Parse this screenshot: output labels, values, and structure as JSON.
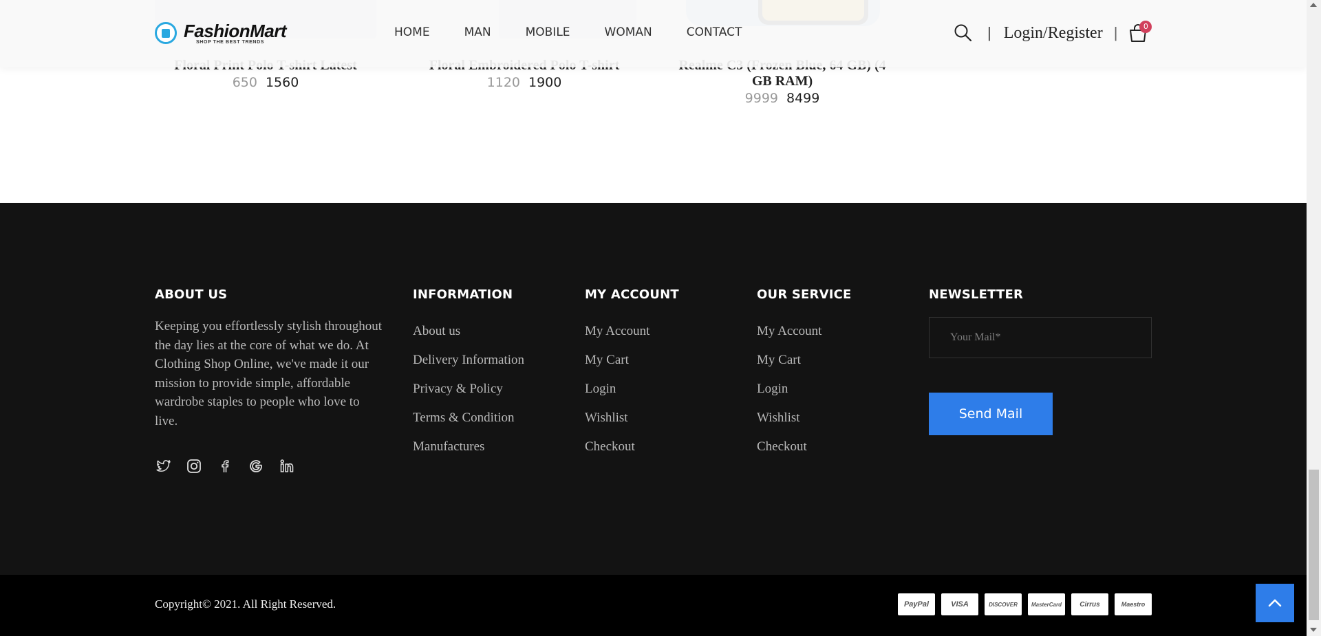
{
  "header": {
    "brand": "FashionMart",
    "tagline": "SHOP THE BEST TRENDS",
    "nav": [
      "HOME",
      "MAN",
      "MOBILE",
      "WOMAN",
      "CONTACT"
    ],
    "login_label": "Login/Register",
    "separator": "|",
    "cart_count": "0"
  },
  "products": [
    {
      "name": "Floral Print Polo T-shirt Latest",
      "old_price": "650",
      "price": "1560"
    },
    {
      "name": "Floral Embroidered Polo T-shirt",
      "old_price": "1120",
      "price": "1900"
    },
    {
      "name": "Realme C3 (Frozen Blue, 64 GB) (4 GB RAM)",
      "old_price": "9999",
      "price": "8499"
    }
  ],
  "footer": {
    "about": {
      "title": "ABOUT US",
      "text": "Keeping you effortlessly stylish throughout the day lies at the core of what we do. At Clothing Shop Online, we've made it our mission to provide simple, affordable wardrobe staples to people who love to live.",
      "social": [
        "twitter-icon",
        "instagram-icon",
        "facebook-icon",
        "google-icon",
        "linkedin-icon"
      ]
    },
    "information": {
      "title": "INFORMATION",
      "links": [
        "About us",
        "Delivery Information",
        "Privacy & Policy",
        "Terms & Condition",
        "Manufactures"
      ]
    },
    "my_account": {
      "title": "MY ACCOUNT",
      "links": [
        "My Account",
        "My Cart",
        "Login",
        "Wishlist",
        "Checkout"
      ]
    },
    "our_service": {
      "title": "OUR SERVICE",
      "links": [
        "My Account",
        "My Cart",
        "Login",
        "Wishlist",
        "Checkout"
      ]
    },
    "newsletter": {
      "title": "NEWSLETTER",
      "placeholder": "Your Mail*",
      "button": "Send Mail"
    },
    "copyright": "Copyright© 2021. All Right Reserved.",
    "payments": [
      "PayPal",
      "VISA",
      "DISCOVER",
      "MasterCard",
      "Cirrus",
      "Maestro"
    ]
  },
  "colors": {
    "accent": "#2e7de9",
    "footer_bg": "#131313",
    "bottom_bar": "#000000",
    "badge": "#d1405c",
    "logo_blue": "#29a8e0"
  }
}
